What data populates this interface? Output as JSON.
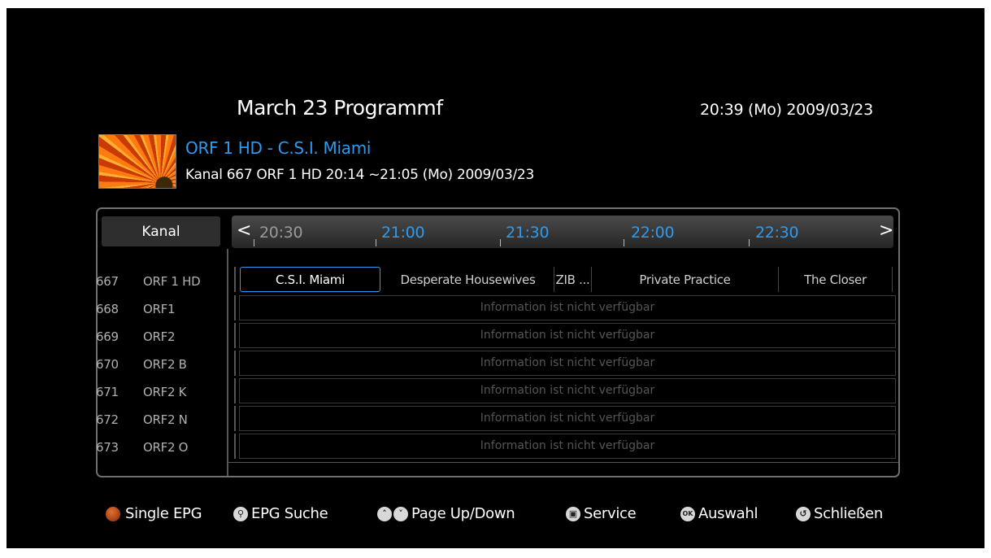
{
  "header": {
    "title": "March 23 Programmf",
    "clock": "20:39 (Mo) 2009/03/23"
  },
  "current_program": {
    "title": "ORF 1 HD - C.S.I. Miami",
    "info": "Kanal 667  ORF 1 HD 20:14 ~21:05 (Mo) 2009/03/23"
  },
  "grid": {
    "channel_header": "Kanal",
    "times": [
      "20:30",
      "21:00",
      "21:30",
      "22:00",
      "22:30"
    ],
    "channels": [
      {
        "number": "667",
        "name": "ORF 1 HD"
      },
      {
        "number": "668",
        "name": "ORF1"
      },
      {
        "number": "669",
        "name": "ORF2"
      },
      {
        "number": "670",
        "name": "ORF2 B"
      },
      {
        "number": "671",
        "name": "ORF2 K"
      },
      {
        "number": "672",
        "name": "ORF2 N"
      },
      {
        "number": "673",
        "name": "ORF2 O"
      }
    ],
    "events_row1": [
      "C.S.I. Miami",
      "Desperate Housewives",
      "ZIB ...",
      "Private Practice",
      "The Closer"
    ],
    "no_info": "Information ist nicht verfügbar"
  },
  "legend": {
    "single_epg": "Single EPG",
    "epg_search": "EPG Suche",
    "page": "Page Up/Down",
    "service": "Service",
    "select": "Auswahl",
    "close": "Schließen"
  },
  "icons": {
    "red": "red-button-icon",
    "search": "search-icon",
    "page": "page-up-down-icon",
    "service": "service-icon",
    "ok": "ok-icon",
    "back": "back-icon"
  },
  "colors": {
    "accent": "#2d9bf0",
    "background": "#000000"
  }
}
